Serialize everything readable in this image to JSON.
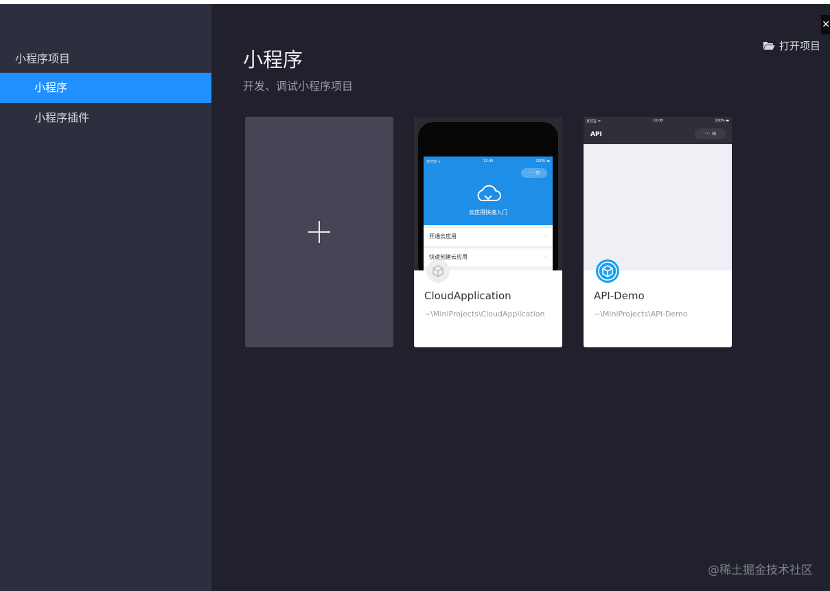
{
  "sidebar": {
    "group_label": "小程序项目",
    "items": [
      {
        "label": "小程序",
        "active": true
      },
      {
        "label": "小程序插件",
        "active": false
      }
    ]
  },
  "header": {
    "title": "小程序",
    "subtitle": "开发、调试小程序项目",
    "open_project_label": "打开项目",
    "open_project_icon": "folder-open-icon",
    "close_icon": "close-icon"
  },
  "new_project": {
    "icon": "plus-icon"
  },
  "projects": [
    {
      "name": "CloudApplication",
      "path": "~\\MiniProjects\\CloudApplication",
      "preview": {
        "status_left": "支付宝 ᯤ",
        "status_time": "13:46",
        "status_right": "100% ▬",
        "banner_label": "云应用快速入门",
        "rows": [
          "开通云应用",
          "快速创建云应用"
        ],
        "accent": "#1f8ee6"
      }
    },
    {
      "name": "API-Demo",
      "path": "~\\MiniProjects\\API-Demo",
      "preview": {
        "status_left": "支付宝 ᯤ",
        "status_time": "10:08",
        "status_right": "100% ▬",
        "title": "API",
        "accent": "#1aa3ef"
      }
    }
  ],
  "watermark": "@稀土掘金技术社区"
}
